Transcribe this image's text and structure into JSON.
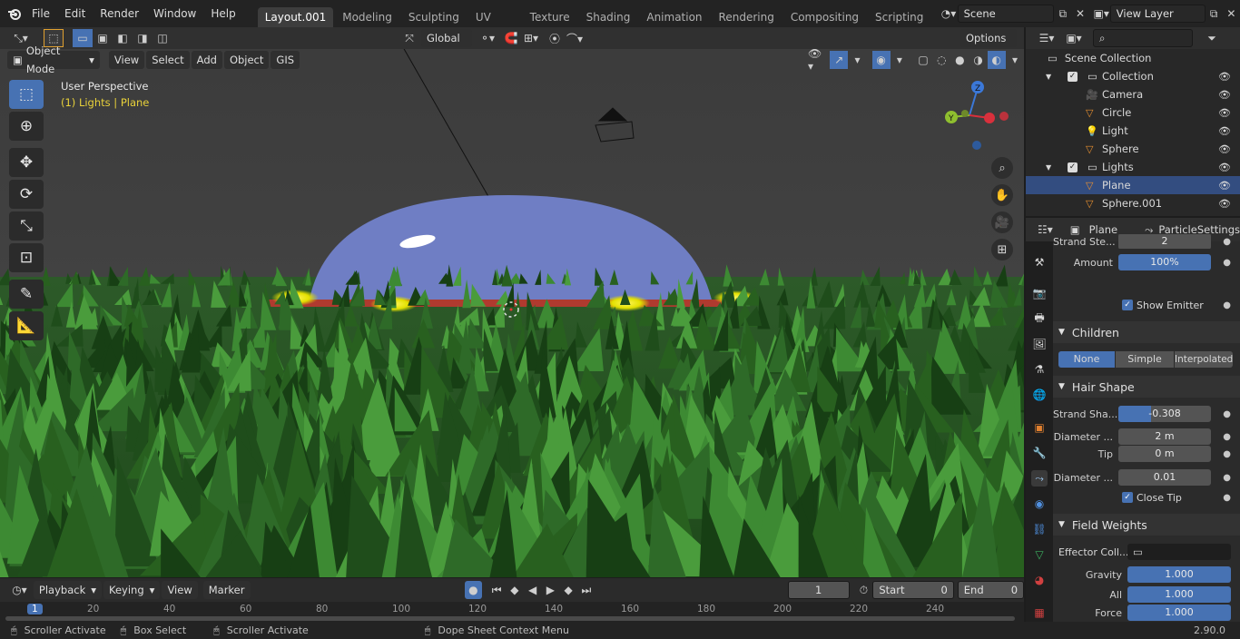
{
  "topbar": {
    "menus": [
      "File",
      "Edit",
      "Render",
      "Window",
      "Help"
    ],
    "workspaces": [
      "Layout.001",
      "Modeling",
      "Sculpting",
      "UV Editing",
      "Texture Paint",
      "Shading",
      "Animation",
      "Rendering",
      "Compositing",
      "Scripting"
    ],
    "active_workspace": "Layout.001",
    "scene_name": "Scene",
    "view_layer": "View Layer"
  },
  "viewport_header": {
    "transform_orientation": "Global",
    "options_label": "Options",
    "mode": "Object Mode",
    "menus": [
      "View",
      "Select",
      "Add",
      "Object",
      "GIS"
    ]
  },
  "viewport": {
    "perspective_label": "User Perspective",
    "context_label": "(1) Lights | Plane",
    "gizmo_axes": [
      "Z",
      "Y"
    ]
  },
  "timeline": {
    "menus": [
      "Playback",
      "Keying",
      "View",
      "Marker"
    ],
    "current_frame": "1",
    "start_label": "Start",
    "start_value": "0",
    "end_label": "End",
    "end_value": "0",
    "ruler_ticks": [
      "1",
      "20",
      "40",
      "60",
      "80",
      "100",
      "120",
      "140",
      "160",
      "180",
      "200",
      "220",
      "240"
    ]
  },
  "statusbar": {
    "items": [
      "Scroller Activate",
      "Box Select",
      "Scroller Activate",
      "Dope Sheet Context Menu"
    ],
    "version": "2.90.0"
  },
  "outliner": {
    "root": "Scene Collection",
    "rows": [
      {
        "label": "Collection",
        "icon": "collection-icon",
        "level": 1
      },
      {
        "label": "Camera",
        "icon": "camera-icon",
        "level": 2
      },
      {
        "label": "Circle",
        "icon": "mesh-icon",
        "level": 2
      },
      {
        "label": "Light",
        "icon": "light-icon",
        "level": 2
      },
      {
        "label": "Sphere",
        "icon": "mesh-icon",
        "level": 2
      },
      {
        "label": "Lights",
        "icon": "collection-icon",
        "level": 1
      },
      {
        "label": "Plane",
        "icon": "mesh-icon",
        "level": 2
      },
      {
        "label": "Sphere.001",
        "icon": "mesh-icon",
        "level": 2
      }
    ]
  },
  "properties": {
    "object_name": "Plane",
    "particle_settings": "ParticleSettings",
    "strand_steps_label": "Strand Ste...",
    "strand_steps_value": "2",
    "amount_label": "Amount",
    "amount_value": "100%",
    "show_emitter_label": "Show Emitter",
    "children_title": "Children",
    "children_options": [
      "None",
      "Simple",
      "Interpolated"
    ],
    "children_selected": "None",
    "hair_shape_title": "Hair Shape",
    "strand_shape_label": "Strand Sha...",
    "strand_shape_value": "-0.308",
    "diameter_root_label": "Diameter ...",
    "diameter_root_value": "2 m",
    "tip_label": "Tip",
    "tip_value": "0 m",
    "diameter_scale_label": "Diameter ...",
    "diameter_scale_value": "0.01",
    "close_tip_label": "Close Tip",
    "field_weights_title": "Field Weights",
    "effector_label": "Effector Coll...",
    "gravity_label": "Gravity",
    "gravity_value": "1.000",
    "all_label": "All",
    "all_value": "1.000",
    "force_label": "Force",
    "force_value": "1.000"
  },
  "colors": {
    "accent": "#4772b3",
    "background": "#1d1d1d",
    "dome": "#6f7ec4",
    "grass": "#2a6a25"
  }
}
